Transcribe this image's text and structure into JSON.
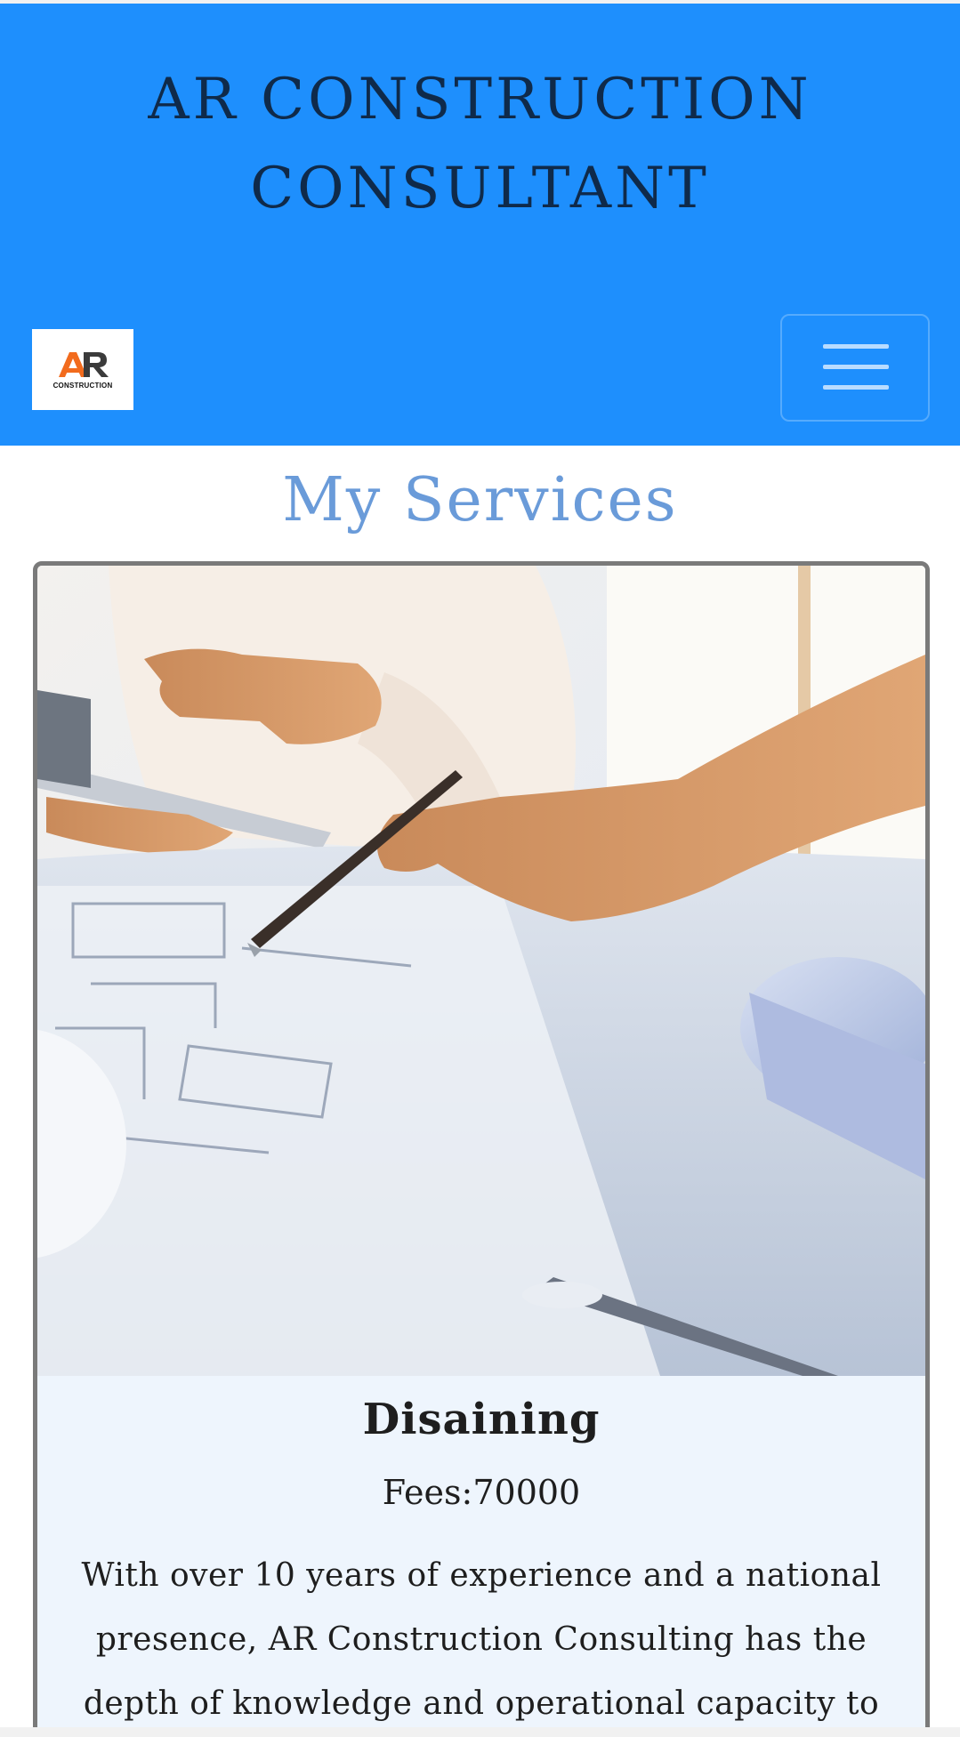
{
  "header": {
    "site_title_line1": "AR CONSTRUCTION",
    "site_title_line2": "CONSULTANT",
    "background_color": "#1e8ffd",
    "logo": {
      "mark": "AR",
      "subtext": "CONSTRUCTION"
    },
    "menu_icon": "hamburger-icon"
  },
  "services": {
    "title": "My Services",
    "title_color": "#6a9bd9",
    "cards": [
      {
        "image_alt": "architects-reviewing-blueprints-photo",
        "name": "Disaining",
        "fees": "Fees:70000",
        "description": "With over 10 years of experience and a national presence, AR Construction Consulting has the depth of knowledge and operational capacity to"
      }
    ]
  }
}
